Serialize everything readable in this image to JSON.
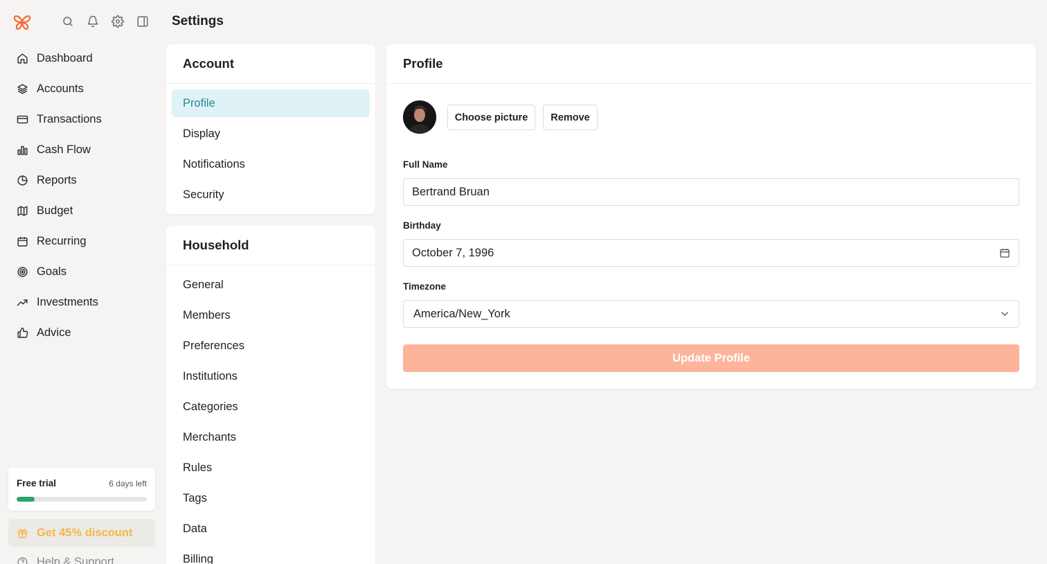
{
  "header": {
    "title": "Settings"
  },
  "top_icons": [
    "logo-icon",
    "search-icon",
    "bell-icon",
    "gear-icon",
    "sidebar-toggle-icon"
  ],
  "sidebar": {
    "items": [
      {
        "label": "Dashboard",
        "icon": "home-icon"
      },
      {
        "label": "Accounts",
        "icon": "layers-icon"
      },
      {
        "label": "Transactions",
        "icon": "credit-card-icon"
      },
      {
        "label": "Cash Flow",
        "icon": "bar-chart-icon"
      },
      {
        "label": "Reports",
        "icon": "pie-chart-icon"
      },
      {
        "label": "Budget",
        "icon": "map-icon"
      },
      {
        "label": "Recurring",
        "icon": "calendar-icon"
      },
      {
        "label": "Goals",
        "icon": "target-icon"
      },
      {
        "label": "Investments",
        "icon": "trending-up-icon"
      },
      {
        "label": "Advice",
        "icon": "thumbs-up-icon"
      }
    ],
    "trial": {
      "title": "Free trial",
      "days_left": "6 days left",
      "progress_fraction": 0.14,
      "color": "#2ea36b"
    },
    "discount": {
      "label": "Get 45% discount",
      "icon": "gift-icon",
      "color": "#f3b84a"
    },
    "help": {
      "label": "Help & Support",
      "icon": "help-icon"
    }
  },
  "settings_menu": {
    "account": {
      "title": "Account",
      "items": [
        "Profile",
        "Display",
        "Notifications",
        "Security"
      ],
      "active": "Profile"
    },
    "household": {
      "title": "Household",
      "items": [
        "General",
        "Members",
        "Preferences",
        "Institutions",
        "Categories",
        "Merchants",
        "Rules",
        "Tags",
        "Data",
        "Billing"
      ]
    }
  },
  "profile": {
    "title": "Profile",
    "choose_picture": "Choose picture",
    "remove": "Remove",
    "full_name_label": "Full Name",
    "full_name": "Bertrand Bruan",
    "birthday_label": "Birthday",
    "birthday": "October 7, 1996",
    "timezone_label": "Timezone",
    "timezone": "America/New_York",
    "update_button": "Update Profile",
    "update_color": "#fdb49a"
  }
}
